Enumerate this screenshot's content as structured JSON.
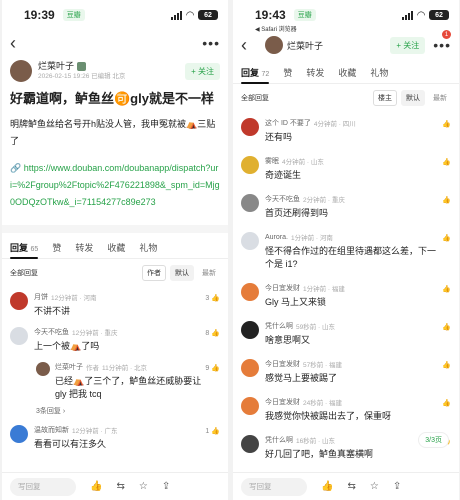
{
  "left": {
    "status": {
      "time": "19:39",
      "app_chip": "豆瓣",
      "battery": "62"
    },
    "author": {
      "name": "烂菜叶子",
      "time": "2026-02-15 19:26 已编辑 北京",
      "follow": "+ 关注"
    },
    "post": {
      "title": "好霸道啊，鲈鱼丝🉑gly就是不一样",
      "body": "明牌鲈鱼丝给名号开h贴没人管，我申冤就被⛺三贴了",
      "link": "🔗 https://www.douban.com/doubanapp/dispatch?uri=%2Fgroup%2Ftopic%2F476221898&_spm_id=Mjg0ODQzOTkw&_i=71154277c89e273"
    },
    "tabs": [
      {
        "label": "回复",
        "count": "65"
      },
      {
        "label": "赞",
        "count": ""
      },
      {
        "label": "转发",
        "count": ""
      },
      {
        "label": "收藏",
        "count": ""
      },
      {
        "label": "礼物",
        "count": ""
      }
    ],
    "sort": {
      "all": "全部回复",
      "author": "作者",
      "default": "默认",
      "newest": "最新"
    },
    "comments": [
      {
        "name": "月饼",
        "meta": "12分钟前 · 河南",
        "text": "不讲不讲",
        "likes": "3"
      },
      {
        "name": "今天不吃鱼",
        "meta": "12分钟前 · 重庆",
        "text": "上一个被⛺了吗",
        "likes": "8"
      }
    ],
    "reply": {
      "name": "烂菜叶子",
      "tag": "作者",
      "meta": "11分钟前 · 北京",
      "text": "已经⛺了三个了，鲈鱼丝还威胁要让 gly 把我 tcq",
      "likes": "9"
    },
    "more_replies": "3条回复",
    "last_comment": {
      "name": "温故而知新",
      "meta": "12分钟前 · 广东",
      "text": "看看可以有汪多久",
      "likes": "1"
    },
    "bottom": {
      "input": "写回复"
    }
  },
  "right": {
    "status": {
      "time": "19:43",
      "app_chip": "豆瓣",
      "battery": "62",
      "back_label": "◀ Safari 浏览器"
    },
    "author": {
      "name": "烂菜叶子",
      "follow": "+ 关注",
      "notice": "1"
    },
    "tabs": [
      {
        "label": "回复",
        "count": "72"
      },
      {
        "label": "赞",
        "count": ""
      },
      {
        "label": "转发",
        "count": ""
      },
      {
        "label": "收藏",
        "count": ""
      },
      {
        "label": "礼物",
        "count": ""
      }
    ],
    "sort": {
      "all": "全部回复",
      "author": "楼主",
      "default": "默认",
      "newest": "最新"
    },
    "comments": [
      {
        "name": "这个 ID 不要了",
        "meta": "4分钟前 · 四川",
        "text": "还有吗",
        "likes": ""
      },
      {
        "name": "雾眠",
        "meta": "4分钟前 · 山东",
        "text": "奇迹诞生",
        "likes": ""
      },
      {
        "name": "今天不吃鱼",
        "meta": "2分钟前 · 重庆",
        "text": "首页还刷得到吗",
        "likes": ""
      },
      {
        "name": "Aurora.",
        "meta": "1分钟前 · 河南",
        "text": "怪不得合作过的在组里待遇都这么差，下一个是 i1?",
        "likes": ""
      },
      {
        "name": "今日宜发财",
        "meta": "1分钟前 · 福建",
        "text": "Gly 马上又来锁",
        "likes": ""
      },
      {
        "name": "凭什么啊",
        "meta": "59秒前 · 山东",
        "text": "啥意思啊又",
        "likes": ""
      },
      {
        "name": "今日宜发财",
        "meta": "57秒前 · 福建",
        "text": "感觉马上要被踢了",
        "likes": ""
      },
      {
        "name": "今日宜发财",
        "meta": "24秒前 · 福建",
        "text": "我感觉你快被踢出去了，保重呀",
        "likes": ""
      },
      {
        "name": "凭什么啊",
        "meta": "16秒前 · 山东",
        "text": "好几回了吧，鲈鱼真塞横啊",
        "likes": ""
      }
    ],
    "page_indicator": "3/3页",
    "bottom": {
      "input": "写回复"
    }
  }
}
